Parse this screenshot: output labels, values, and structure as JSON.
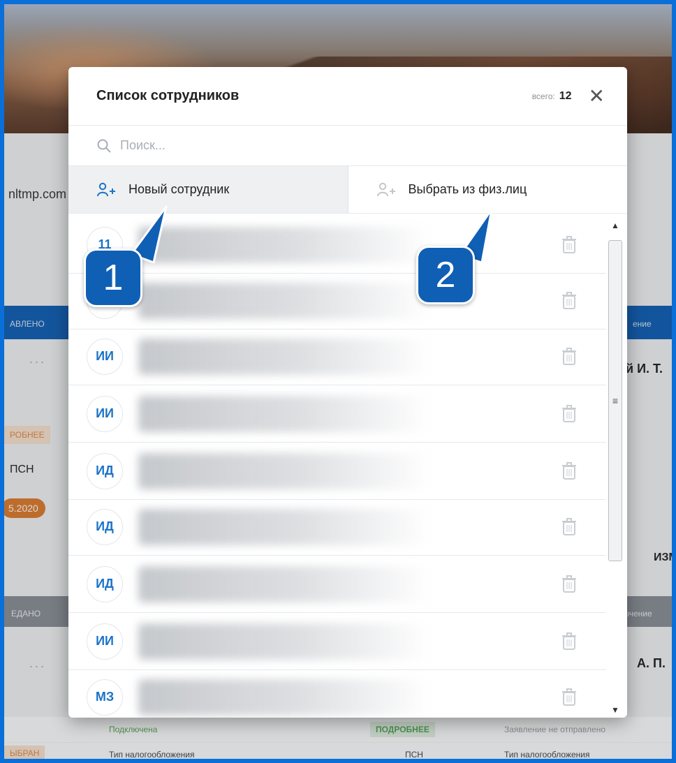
{
  "background": {
    "email_fragment": "nltmp.com",
    "status_sent": "АВЛЕНО",
    "status_transferred": "ЕДАНО",
    "status_selected": "ЫБРАН",
    "details_badge": "РОБНЕЕ",
    "tax_short": "ПСН",
    "date_fragment": "5.2020",
    "name_fragment_1": "й И. Т.",
    "name_fragment_2": "А. П.",
    "edit_fragment": "ИЗМ",
    "status_right_1": "ение",
    "status_right_2": "ючение",
    "footer": {
      "connected": "Подключена",
      "details": "ПОДРОБНЕЕ",
      "statement": "Заявление не отправлено",
      "tax_label": "Тип налогообложения",
      "tax_value": "ПСН",
      "tax_label_2": "Тип налогообложения"
    },
    "dots": "..."
  },
  "modal": {
    "title": "Список сотрудников",
    "total_label": "всего:",
    "total_value": "12",
    "close_icon": "close-icon",
    "search": {
      "placeholder": "Поиск...",
      "value": ""
    },
    "tabs": [
      {
        "label": "Новый сотрудник",
        "icon": "add-user-icon",
        "active": true
      },
      {
        "label": "Выбрать из физ.лиц",
        "icon": "add-user-icon",
        "active": false
      }
    ],
    "employees": [
      {
        "initials": "11"
      },
      {
        "initials": ""
      },
      {
        "initials": "ИИ"
      },
      {
        "initials": "ИИ"
      },
      {
        "initials": "ИД"
      },
      {
        "initials": "ИД"
      },
      {
        "initials": "ИД"
      },
      {
        "initials": "ИИ"
      },
      {
        "initials": "МЗ"
      }
    ]
  },
  "callouts": [
    {
      "label": "1"
    },
    {
      "label": "2"
    }
  ],
  "colors": {
    "accent": "#1a73c8",
    "callout": "#0f5fb5",
    "frame": "#0a6fd8"
  }
}
